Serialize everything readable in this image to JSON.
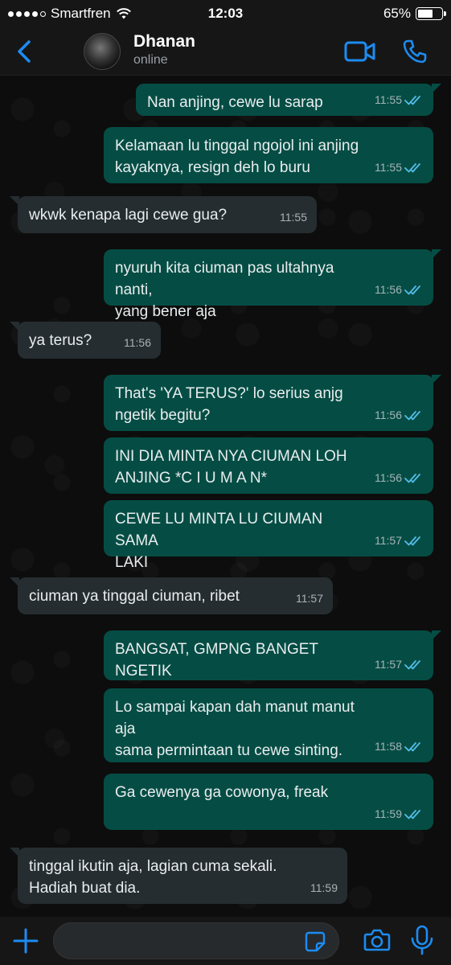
{
  "status_bar": {
    "carrier": "Smartfren",
    "time": "12:03",
    "battery_percent": "65%",
    "battery_level": 0.65,
    "signal_bars_filled": 4,
    "signal_bars_total": 5
  },
  "header": {
    "back_icon": "chevron-left-icon",
    "contact_name": "Dhanan",
    "contact_status": "online",
    "video_icon": "video-call-icon",
    "phone_icon": "phone-icon",
    "accent_color": "#1c8cf2"
  },
  "messages": [
    {
      "dir": "out",
      "text": "Nan anjing, cewe lu sarap",
      "time": "11:55",
      "read": true
    },
    {
      "dir": "out",
      "text": "Kelamaan lu tinggal ngojol ini anjing\nkayaknya, resign deh lo buru",
      "time": "11:55",
      "read": true
    },
    {
      "dir": "in",
      "text": "wkwk kenapa lagi cewe gua?",
      "time": "11:55"
    },
    {
      "dir": "out",
      "text": "nyuruh kita ciuman pas ultahnya nanti,\nyang bener aja",
      "time": "11:56",
      "read": true
    },
    {
      "dir": "in",
      "text": "ya terus?",
      "time": "11:56"
    },
    {
      "dir": "out",
      "text": "That's 'YA TERUS?' lo serius anjg\nngetik begitu?",
      "time": "11:56",
      "read": true
    },
    {
      "dir": "out",
      "text": "INI DIA MINTA NYA CIUMAN LOH\nANJING *C I U M A N*",
      "time": "11:56",
      "read": true
    },
    {
      "dir": "out",
      "text": "CEWE LU MINTA LU CIUMAN SAMA\nLAKI",
      "time": "11:57",
      "read": true
    },
    {
      "dir": "in",
      "text": "ciuman ya tinggal ciuman, ribet",
      "time": "11:57"
    },
    {
      "dir": "out",
      "text": "BANGSAT, GMPNG BANGET NGETIK",
      "time": "11:57",
      "read": true
    },
    {
      "dir": "out",
      "text": "Lo sampai kapan dah manut manut aja\nsama permintaan tu cewe sinting.",
      "time": "11:58",
      "read": true
    },
    {
      "dir": "out",
      "text": "Ga cewenya ga cowonya, freak",
      "time": "11:59",
      "read": true
    },
    {
      "dir": "in",
      "text": "tinggal ikutin aja, lagian cuma sekali.\nHadiah buat dia.",
      "time": "11:59"
    }
  ],
  "input_bar": {
    "plus_icon": "plus-icon",
    "placeholder": "",
    "sticker_icon": "sticker-icon",
    "camera_icon": "camera-icon",
    "mic_icon": "microphone-icon"
  },
  "colors": {
    "outgoing_bubble": "#054d44",
    "incoming_bubble": "#262d31",
    "read_ticks": "#53bdeb"
  }
}
